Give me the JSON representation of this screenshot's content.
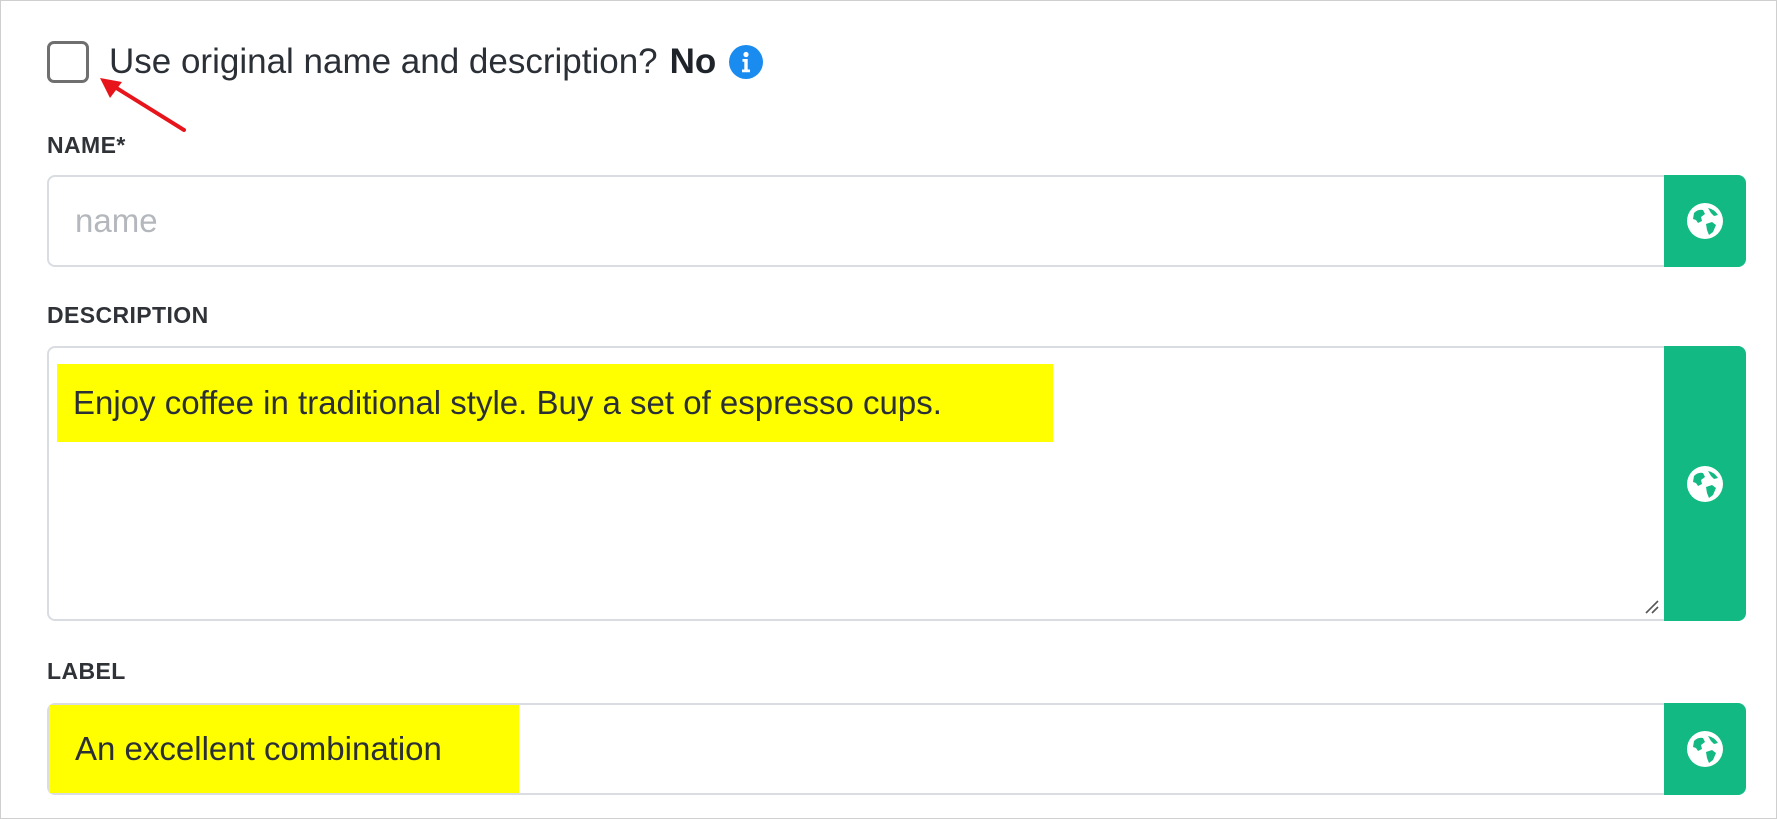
{
  "toggle": {
    "label": "Use original name and description?",
    "value": "No",
    "checked": false,
    "info_icon": "info-circle-icon"
  },
  "fields": {
    "name": {
      "label": "NAME*",
      "placeholder": "name",
      "value": "",
      "button_icon": "globe-icon"
    },
    "description": {
      "label": "DESCRIPTION",
      "value": "Enjoy coffee in traditional style. Buy a set of espresso cups.",
      "button_icon": "globe-icon"
    },
    "label": {
      "label": "LABEL",
      "value": "An excellent combination",
      "button_icon": "globe-icon"
    }
  },
  "colors": {
    "accent_green": "#13b982",
    "info_blue": "#1a8cf0",
    "highlight_yellow": "#ffff00",
    "annotation_red": "#e8141b"
  }
}
